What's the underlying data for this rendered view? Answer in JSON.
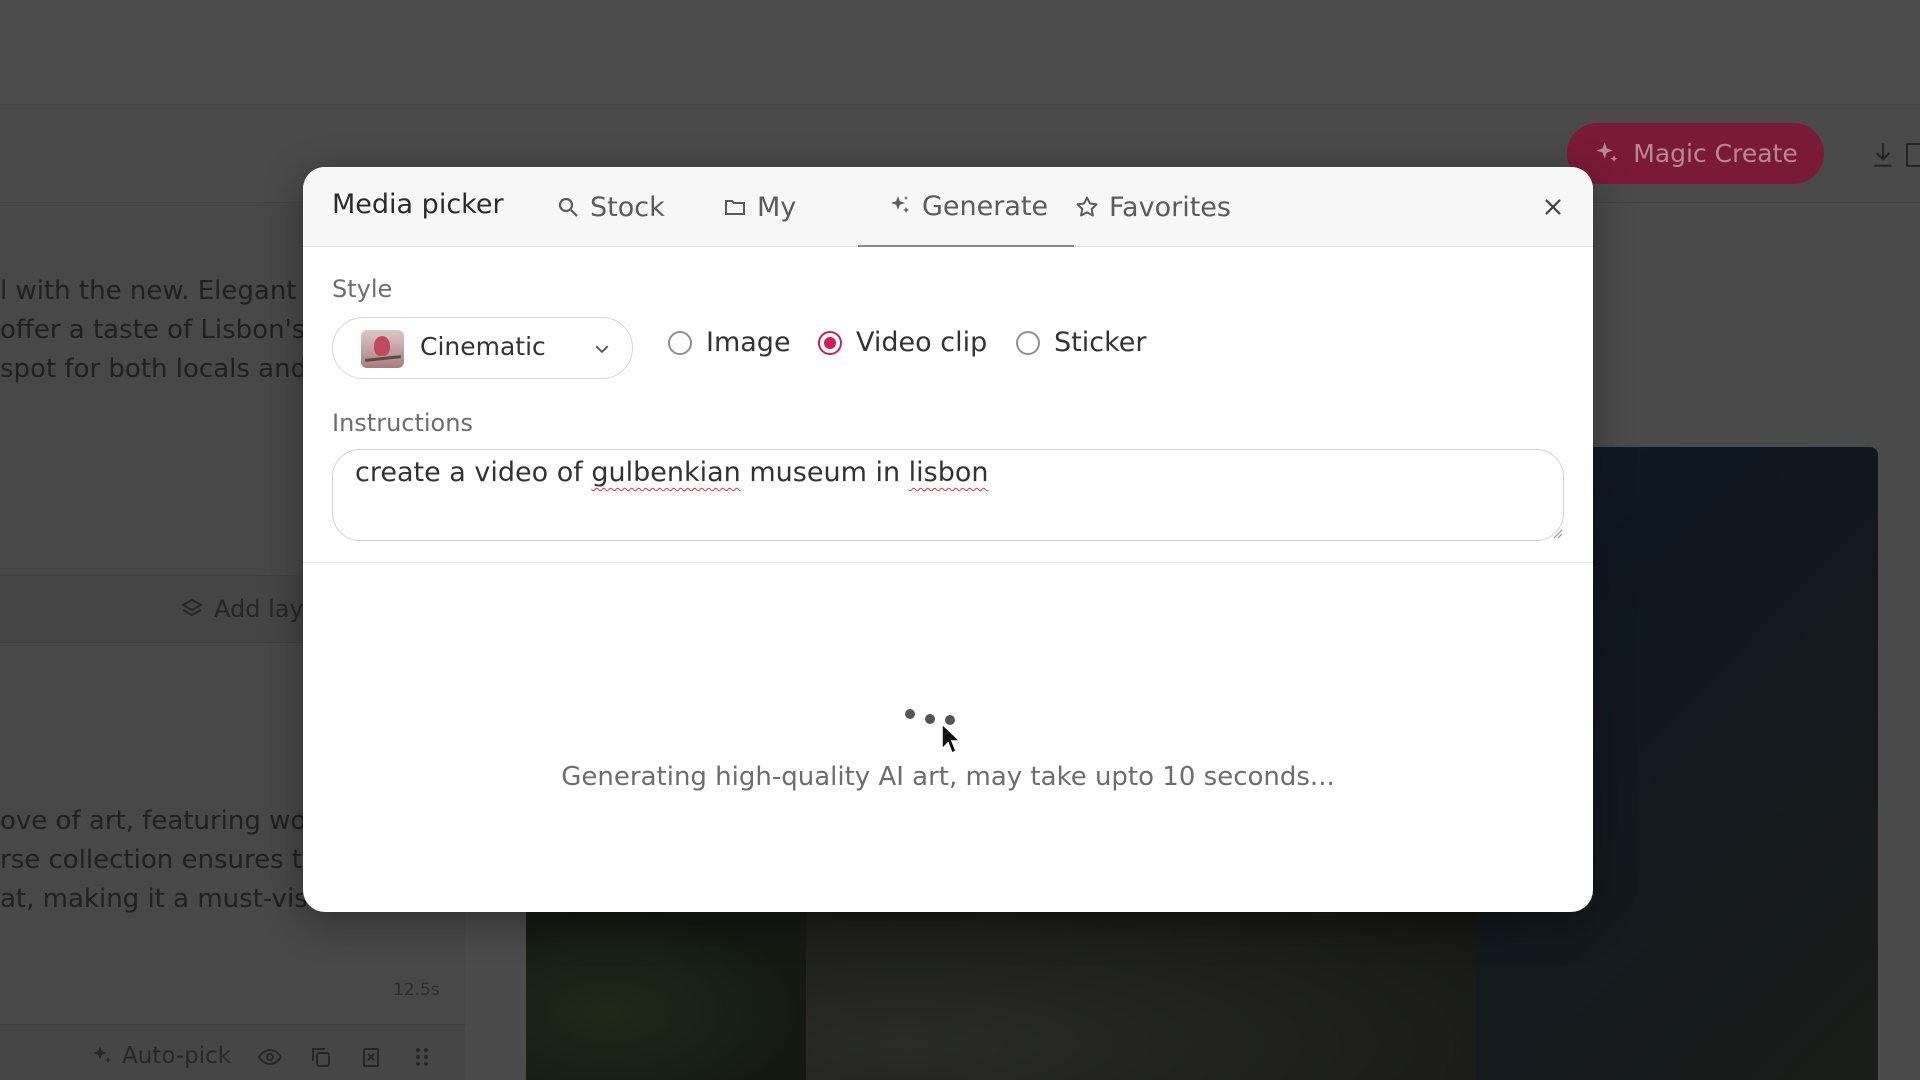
{
  "background": {
    "magic_create_label": "Magic Create",
    "text_block_1": [
      "l with the new. Elegant",
      "offer a taste of Lisbon's",
      "spot for both locals and"
    ],
    "text_block_2": [
      "ove of art, featuring wor",
      "rse collection ensures tl",
      "at, making it a must-visi"
    ],
    "add_layer_label": "Add lay",
    "duration": "12.5s",
    "auto_pick_label": "Auto-pick"
  },
  "modal": {
    "title": "Media picker",
    "tabs": [
      {
        "label": "Stock",
        "icon": "search-icon"
      },
      {
        "label": "My",
        "icon": "folder-icon"
      },
      {
        "label": "Generate",
        "icon": "sparkle-icon",
        "active": true
      },
      {
        "label": "Favorites",
        "icon": "star-icon"
      }
    ],
    "style_label": "Style",
    "style_value": "Cinematic",
    "media_types": [
      {
        "label": "Image",
        "checked": false
      },
      {
        "label": "Video clip",
        "checked": true
      },
      {
        "label": "Sticker",
        "checked": false
      }
    ],
    "instructions_label": "Instructions",
    "instructions_parts": [
      "create a video of ",
      "gulbenkian",
      " museum in ",
      "lisbon"
    ],
    "status": "Generating high-quality AI art, may take upto 10 seconds..."
  },
  "colors": {
    "accent": "#d21b57",
    "magic_create_dimmed": "#7a1a38",
    "overlay": "#4b4b4b"
  }
}
